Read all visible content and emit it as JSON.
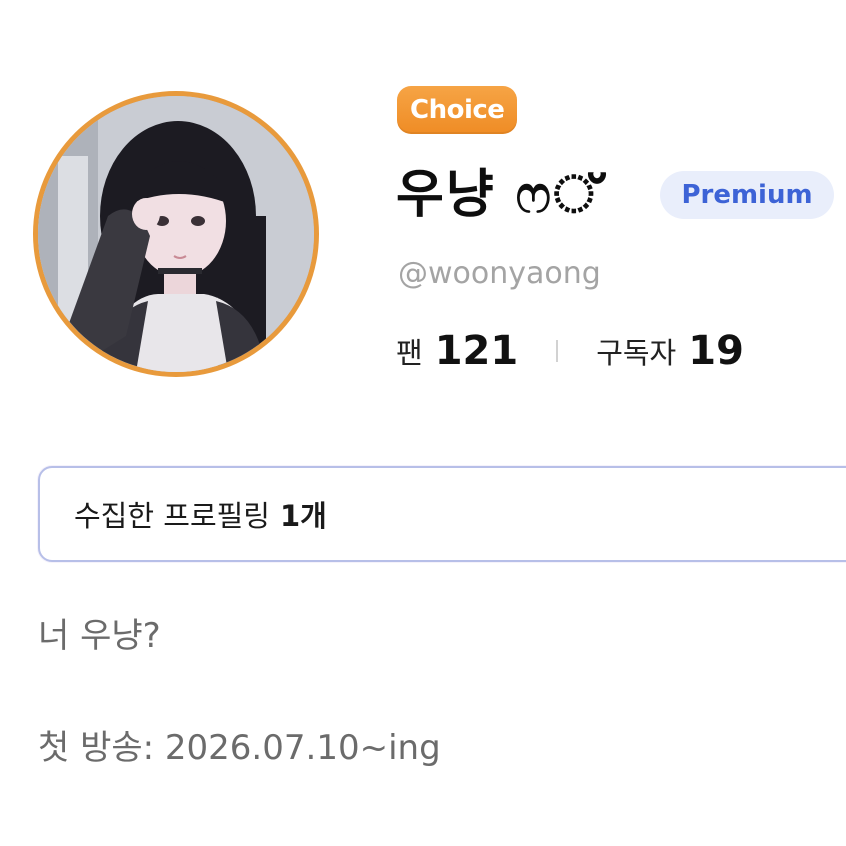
{
  "profile": {
    "badge": "Choice",
    "display_name": "우냥 ෆ്",
    "tier_badge": "Premium",
    "handle": "@woonyaong",
    "avatar_icon": "avatar-photo",
    "colors": {
      "avatar_ring": "#e89a3c",
      "choice_badge": "#f29a36",
      "premium_bg": "#e9eefb",
      "premium_text": "#3d63d6",
      "card_border": "#b7bfe8"
    }
  },
  "stats": {
    "fans_label": "팬",
    "fans_value": "121",
    "subscribers_label": "구독자",
    "subscribers_value": "19"
  },
  "collection": {
    "label": "수집한 프로필링",
    "count": "1개"
  },
  "bio": {
    "line1": "너 우냥?",
    "line2": "첫 방송: 2026.07.10~ing"
  }
}
